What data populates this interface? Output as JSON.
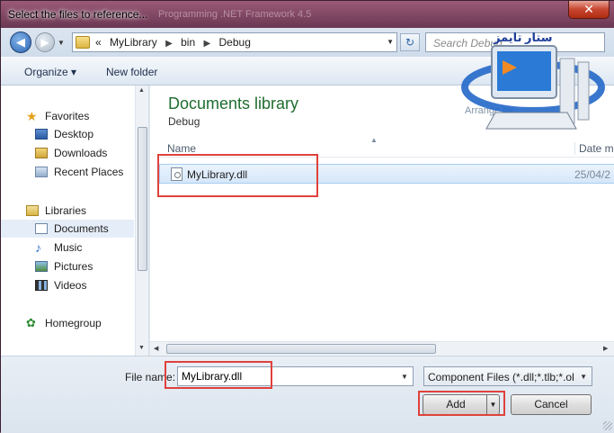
{
  "window": {
    "title": "Select the files to reference...",
    "title_ghost": "Programming .NET Framework 4.5",
    "close_glyph": "✕"
  },
  "nav": {
    "back_glyph": "◀",
    "forward_glyph": "▶"
  },
  "address": {
    "prefix": "«",
    "crumbs": [
      "MyLibrary",
      "bin",
      "Debug"
    ],
    "separator": "▶"
  },
  "search": {
    "placeholder": "Search Debug"
  },
  "toolbar": {
    "organize_label": "Organize ▾",
    "new_folder_label": "New folder"
  },
  "sidebar": {
    "favorites": {
      "label": "Favorites",
      "items": [
        {
          "label": "Desktop",
          "icon": "desktop-icon"
        },
        {
          "label": "Downloads",
          "icon": "downloads-folder-icon"
        },
        {
          "label": "Recent Places",
          "icon": "recent-places-icon"
        }
      ]
    },
    "libraries": {
      "label": "Libraries",
      "items": [
        {
          "label": "Documents",
          "icon": "documents-icon"
        },
        {
          "label": "Music",
          "icon": "music-icon"
        },
        {
          "label": "Pictures",
          "icon": "pictures-icon"
        },
        {
          "label": "Videos",
          "icon": "videos-icon"
        }
      ]
    },
    "homegroup": {
      "label": "Homegroup"
    }
  },
  "main": {
    "library_title": "Documents library",
    "library_sub": "Debug",
    "arrange_label": "Arrange by:",
    "columns": {
      "name": "Name",
      "date": "Date m"
    },
    "files": [
      {
        "name": "MyLibrary.dll",
        "date": "25/04/2"
      }
    ]
  },
  "footer": {
    "file_name_label": "File name:",
    "file_name_value": "MyLibrary.dll",
    "filter_value": "Component Files (*.dll;*.tlb;*.ol",
    "add_label": "Add",
    "cancel_label": "Cancel"
  },
  "watermark": {
    "text": "ستار تايمز"
  },
  "colors": {
    "highlight": "#e0413c",
    "library_title": "#1f6d2f",
    "selection": "#d6e7fa"
  }
}
